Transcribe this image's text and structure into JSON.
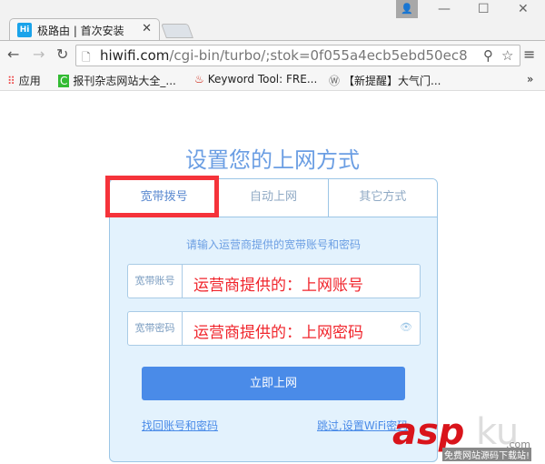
{
  "browser": {
    "tab_title": "极路由 | 首次安装",
    "favicon": "Hi",
    "url_host": "hiwifi.com",
    "url_path": "/cgi-bin/turbo/;stok=0f055a4ecb5ebd50ec8",
    "bookmarks": [
      {
        "label": "应用",
        "icon": "apps-grid-icon"
      },
      {
        "label": "报刊杂志网站大全_...",
        "icon": "refresh-green-icon"
      },
      {
        "label": "Keyword Tool: FRE...",
        "icon": "flame-icon"
      },
      {
        "label": "【新提醒】大气门...",
        "icon": "wordpress-icon"
      }
    ],
    "overflow": "»"
  },
  "page": {
    "title": "设置您的上网方式",
    "tabs": [
      "宽带拨号",
      "自动上网",
      "其它方式"
    ],
    "hint": "请输入运营商提供的宽带账号和密码",
    "account_label": "宽带账号",
    "account_value": "运营商提供的：上网账号",
    "password_label": "宽带密码",
    "password_value": "运营商提供的：上网密码",
    "submit": "立即上网",
    "recover_link": "找回账号和密码",
    "skip_link": "跳过,设置WiFi密码"
  },
  "watermark": {
    "brand_a": "asp",
    "brand_b": "ku",
    "domain": ".com",
    "tagline": "免费网站源码下载站!"
  },
  "colors": {
    "accent": "#4a8be8",
    "highlight": "#f5333a",
    "panel": "#e3f2fd"
  }
}
